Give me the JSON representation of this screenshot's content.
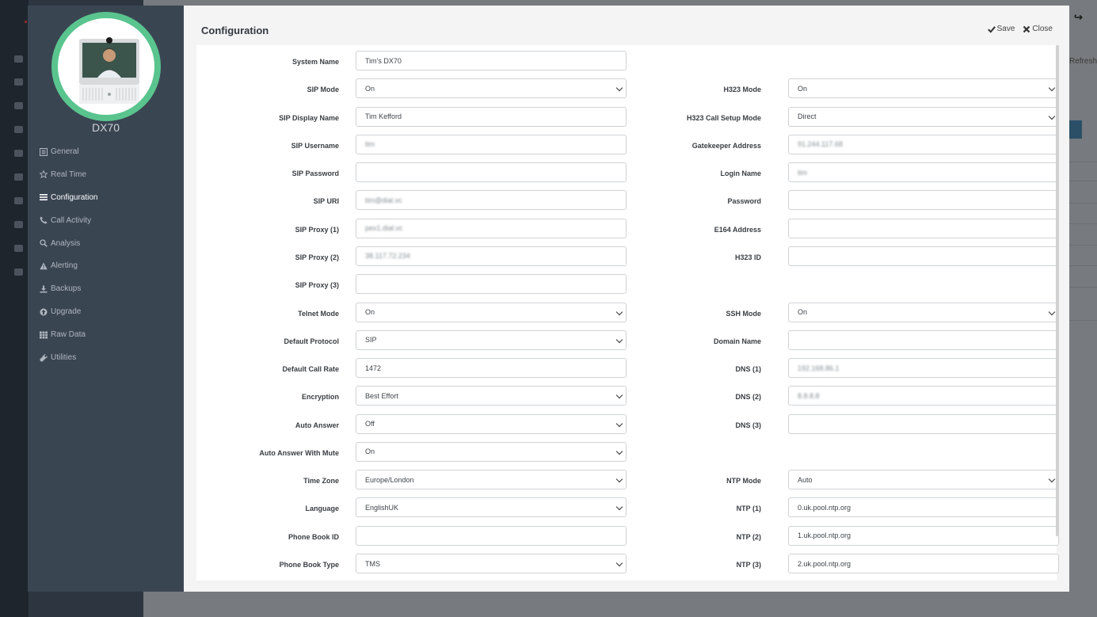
{
  "device": {
    "name": "DX70"
  },
  "nav": [
    {
      "label": "General",
      "icon": "list-icon",
      "active": false
    },
    {
      "label": "Real Time",
      "icon": "star-icon",
      "active": false
    },
    {
      "label": "Configuration",
      "icon": "bars-icon",
      "active": true
    },
    {
      "label": "Call Activity",
      "icon": "phone-icon",
      "active": false
    },
    {
      "label": "Analysis",
      "icon": "search-icon",
      "active": false
    },
    {
      "label": "Alerting",
      "icon": "warning-icon",
      "active": false
    },
    {
      "label": "Backups",
      "icon": "download-icon",
      "active": false
    },
    {
      "label": "Upgrade",
      "icon": "upgrade-icon",
      "active": false
    },
    {
      "label": "Raw Data",
      "icon": "grid-icon",
      "active": false
    },
    {
      "label": "Utilities",
      "icon": "wrench-icon",
      "active": false
    }
  ],
  "header": {
    "title": "Configuration",
    "save_label": "Save",
    "close_label": "Close"
  },
  "background": {
    "refresh_label": "Refresh"
  },
  "left_fields": [
    {
      "label": "System Name",
      "value": "Tim's DX70",
      "type": "text"
    },
    {
      "label": "SIP Mode",
      "value": "On",
      "type": "select"
    },
    {
      "label": "SIP Display Name",
      "value": "Tim Kefford",
      "type": "text"
    },
    {
      "label": "SIP Username",
      "value": "tim",
      "type": "text",
      "blurred": true
    },
    {
      "label": "SIP Password",
      "value": "",
      "type": "text"
    },
    {
      "label": "SIP URI",
      "value": "tim@dial.vc",
      "type": "text",
      "blurred": true
    },
    {
      "label": "SIP Proxy (1)",
      "value": "pex1.dial.vc",
      "type": "text",
      "blurred": true
    },
    {
      "label": "SIP Proxy (2)",
      "value": "38.117.72.234",
      "type": "text",
      "blurred": true
    },
    {
      "label": "SIP Proxy (3)",
      "value": "",
      "type": "text"
    },
    {
      "label": "Telnet Mode",
      "value": "On",
      "type": "select"
    },
    {
      "label": "Default Protocol",
      "value": "SIP",
      "type": "select"
    },
    {
      "label": "Default Call Rate",
      "value": "1472",
      "type": "text"
    },
    {
      "label": "Encryption",
      "value": "Best Effort",
      "type": "select"
    },
    {
      "label": "Auto Answer",
      "value": "Off",
      "type": "select"
    },
    {
      "label": "Auto Answer With Mute",
      "value": "On",
      "type": "select"
    },
    {
      "label": "Time Zone",
      "value": "Europe/London",
      "type": "select"
    },
    {
      "label": "Language",
      "value": "EnglishUK",
      "type": "select"
    },
    {
      "label": "Phone Book ID",
      "value": "",
      "type": "text"
    },
    {
      "label": "Phone Book Type",
      "value": "TMS",
      "type": "select"
    }
  ],
  "right_fields": [
    null,
    {
      "label": "H323 Mode",
      "value": "On",
      "type": "select"
    },
    {
      "label": "H323 Call Setup Mode",
      "value": "Direct",
      "type": "select"
    },
    {
      "label": "Gatekeeper Address",
      "value": "91.244.117.68",
      "type": "text",
      "blurred": true
    },
    {
      "label": "Login Name",
      "value": "tim",
      "type": "text",
      "blurred": true
    },
    {
      "label": "Password",
      "value": "",
      "type": "text"
    },
    {
      "label": "E164 Address",
      "value": "",
      "type": "text"
    },
    {
      "label": "H323 ID",
      "value": "",
      "type": "text"
    },
    null,
    {
      "label": "SSH Mode",
      "value": "On",
      "type": "select"
    },
    {
      "label": "Domain Name",
      "value": "",
      "type": "text"
    },
    {
      "label": "DNS (1)",
      "value": "192.168.86.1",
      "type": "text",
      "blurred": true
    },
    {
      "label": "DNS (2)",
      "value": "8.8.8.8",
      "type": "text",
      "blurred": true
    },
    {
      "label": "DNS (3)",
      "value": "",
      "type": "text"
    },
    null,
    {
      "label": "NTP Mode",
      "value": "Auto",
      "type": "select"
    },
    {
      "label": "NTP (1)",
      "value": "0.uk.pool.ntp.org",
      "type": "text"
    },
    {
      "label": "NTP (2)",
      "value": "1.uk.pool.ntp.org",
      "type": "text"
    },
    {
      "label": "NTP (3)",
      "value": "2.uk.pool.ntp.org",
      "type": "text"
    }
  ]
}
